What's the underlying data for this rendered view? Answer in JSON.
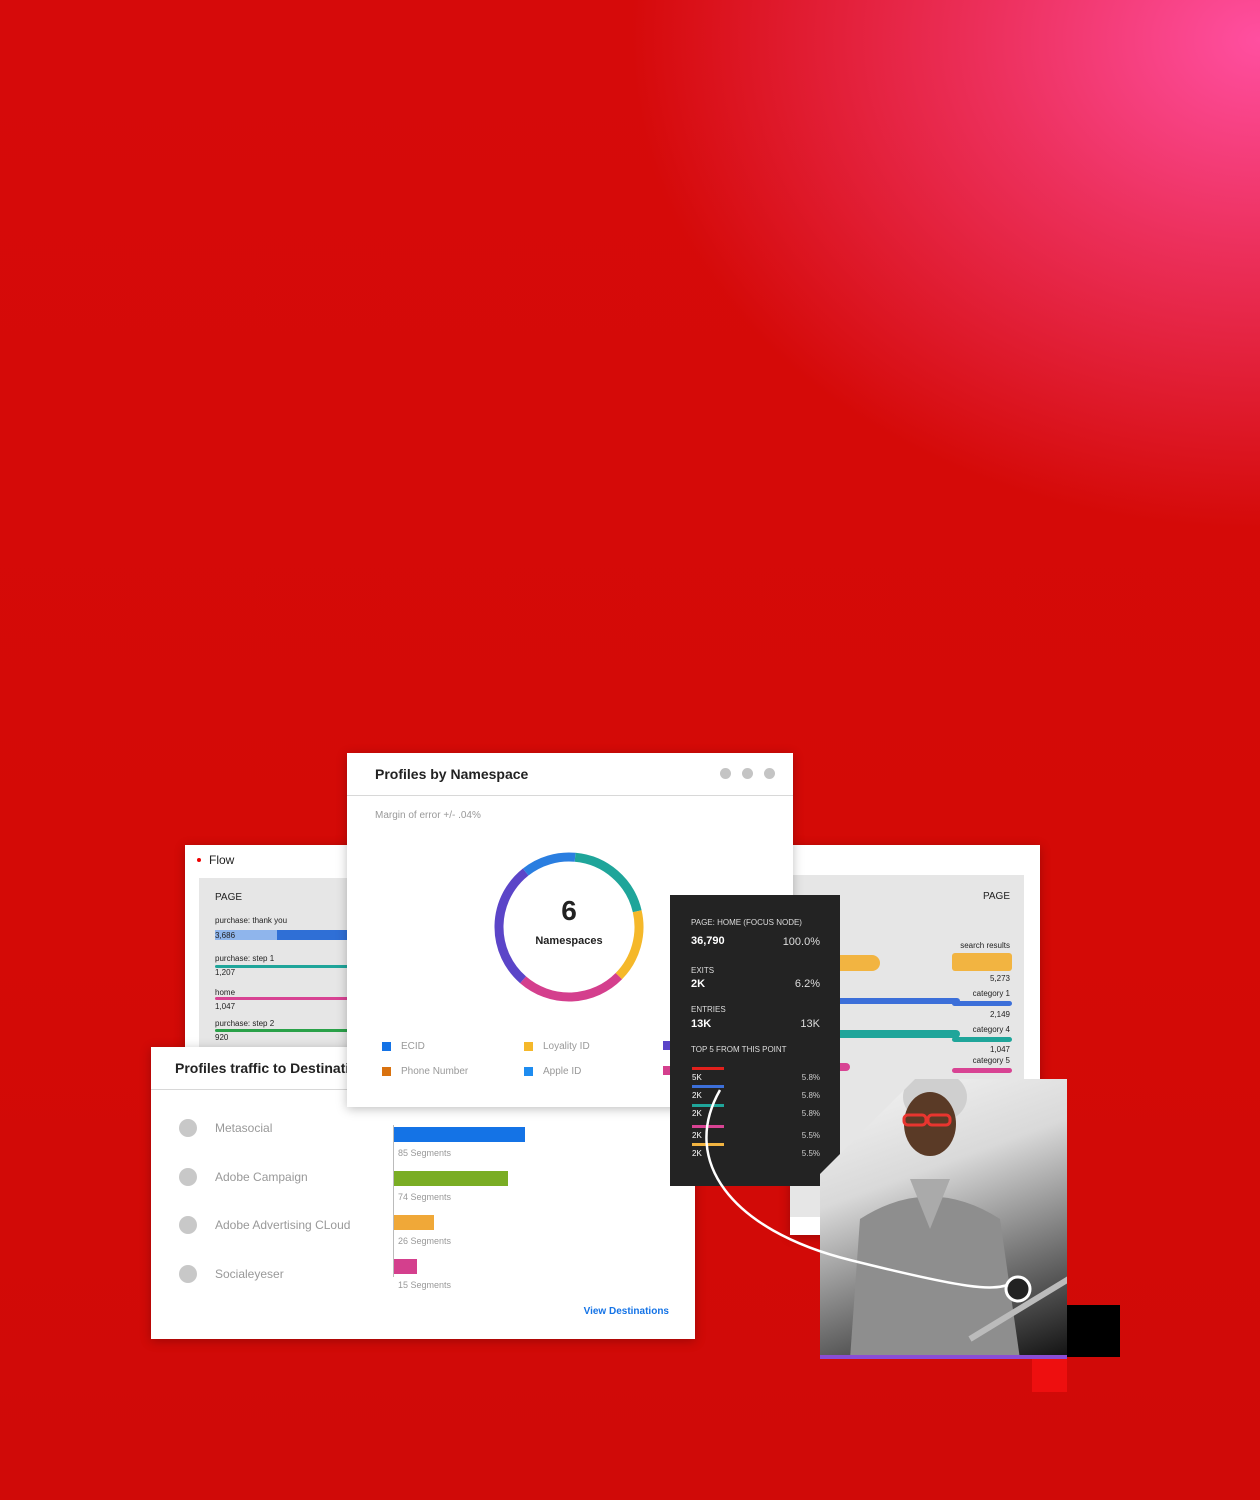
{
  "flow_left": {
    "title": "Flow",
    "page_label": "PAGE",
    "items": [
      {
        "label": "purchase: thank you",
        "value": "3,686",
        "color": "#2f6fd6"
      },
      {
        "label": "purchase: step 1",
        "value": "1,207",
        "color": "#1fa59a"
      },
      {
        "label": "home",
        "value": "1,047",
        "color": "#d84393"
      },
      {
        "label": "purchase: step 2",
        "value": "920",
        "color": "#2aa149"
      }
    ]
  },
  "flow_right": {
    "page_label": "PAGE",
    "items": [
      {
        "label": "search results",
        "value": "5,273",
        "color": "#f2b441"
      },
      {
        "label": "category 1",
        "value": "2,149",
        "color": "#3c6fd9"
      },
      {
        "label": "category 4",
        "value": "1,047",
        "color": "#1fa59a"
      },
      {
        "label": "category 5",
        "value": "",
        "color": "#d84393"
      }
    ]
  },
  "namespace": {
    "title": "Profiles by Namespace",
    "margin_text": "Margin of error +/- .04%",
    "count": "6",
    "count_label": "Namespaces",
    "legend": [
      {
        "label": "ECID",
        "color": "#1473e6"
      },
      {
        "label": "Loyality ID",
        "color": "#f5b82a"
      },
      {
        "label": "Phone Number",
        "color": "#d9720f"
      },
      {
        "label": "Apple ID",
        "color": "#1e8cf0"
      }
    ],
    "segments": [
      {
        "value": 20,
        "color": "#1fa59a"
      },
      {
        "value": 16,
        "color": "#f5b82a"
      },
      {
        "value": 24,
        "color": "#d43f8d"
      },
      {
        "value": 28,
        "color": "#5b45c8"
      },
      {
        "value": 12,
        "color": "#2a7ee0"
      }
    ]
  },
  "traffic": {
    "title": "Profiles traffic to Destinations",
    "destinations": [
      {
        "name": "Metasocial",
        "segments": "85 Segments",
        "value": 85,
        "color": "#1473e6"
      },
      {
        "name": "Adobe Campaign",
        "segments": "74 Segments",
        "value": 74,
        "color": "#7aad24"
      },
      {
        "name": "Adobe Advertising CLoud",
        "segments": "26 Segments",
        "value": 26,
        "color": "#f0a838"
      },
      {
        "name": "Socialeyeser",
        "segments": "15 Segments",
        "value": 15,
        "color": "#d43f8d"
      }
    ],
    "view_link": "View Destinations"
  },
  "tooltip": {
    "focus_label": "PAGE: HOME (FOCUS NODE)",
    "focus_value": "36,790",
    "focus_pct": "100.0%",
    "exits_label": "EXITS",
    "exits_value": "2K",
    "exits_pct": "6.2%",
    "entries_label": "ENTRIES",
    "entries_value": "13K",
    "entries_pct": "13K",
    "top5_label": "TOP 5 FROM THIS POINT",
    "top5": [
      {
        "value": "5K",
        "pct": "5.8%",
        "color": "#e2201c"
      },
      {
        "value": "2K",
        "pct": "5.8%",
        "color": "#3c6fd9"
      },
      {
        "value": "2K",
        "pct": "5.8%",
        "color": "#1fa59a"
      },
      {
        "value": "2K",
        "pct": "5.5%",
        "color": "#d84393"
      },
      {
        "value": "2K",
        "pct": "5.5%",
        "color": "#f2b441"
      }
    ]
  }
}
